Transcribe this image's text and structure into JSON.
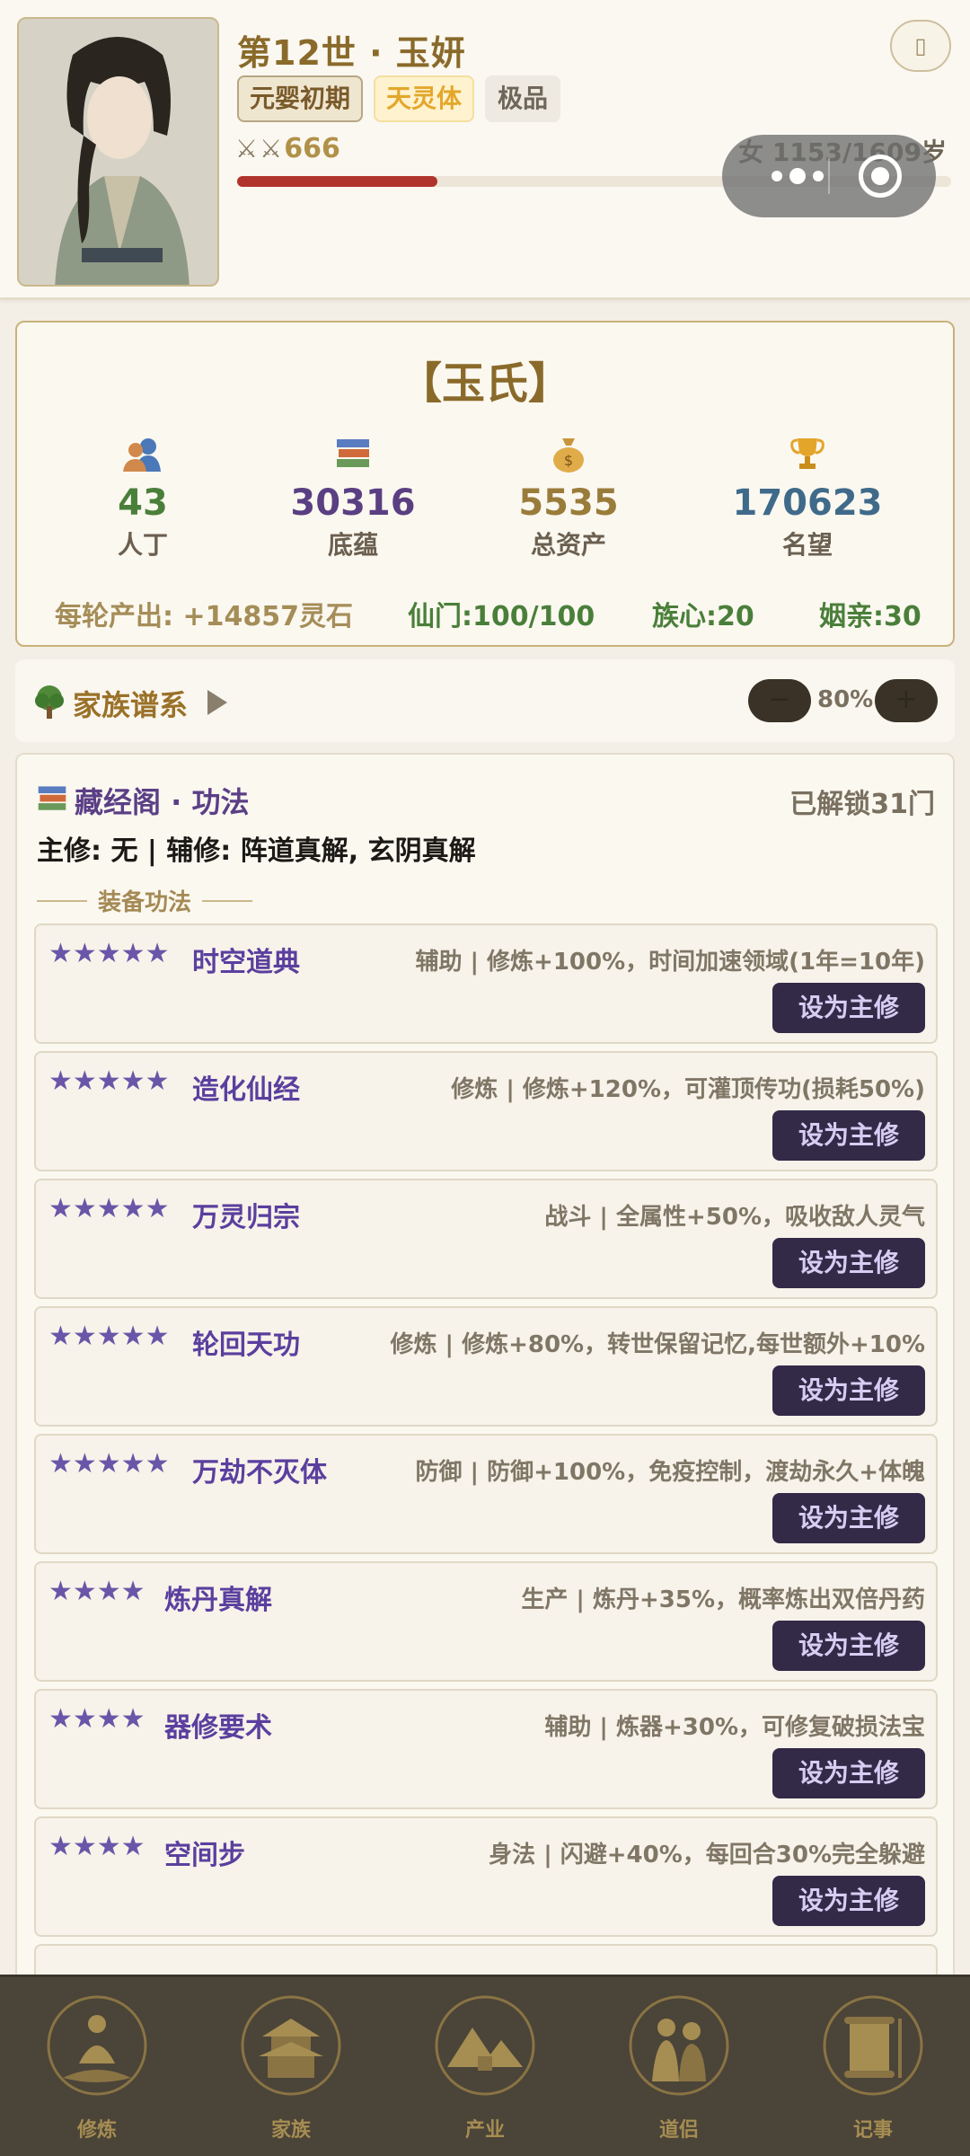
{
  "header": {
    "title": "第12世 · 玉妍",
    "badges": {
      "realm": "元婴初期",
      "body": "天灵体",
      "grade": "极品"
    },
    "power": "666",
    "age": "女 1153/1609岁",
    "hp_fraction": 0.28
  },
  "clan": {
    "name": "【玉氏】",
    "stats": [
      {
        "value": "43",
        "label": "人丁",
        "icon": "people-icon"
      },
      {
        "value": "30316",
        "label": "底蕴",
        "icon": "books-icon"
      },
      {
        "value": "5535",
        "label": "总资产",
        "icon": "money-bag-icon"
      },
      {
        "value": "170623",
        "label": "名望",
        "icon": "trophy-icon"
      }
    ],
    "footer": {
      "output": "每轮产出: +14857灵石",
      "sect": "仙门:100/100",
      "heart": "族心:20",
      "marriage": "姻亲:30"
    }
  },
  "family": {
    "label": "家族谱系",
    "zoom": "80%",
    "zoom_minus": "−",
    "zoom_plus": "+"
  },
  "library": {
    "title": "藏经阁 · 功法",
    "unlocked": "已解锁31门",
    "cultivation": "主修: 无 | 辅修: 阵道真解, 玄阴真解",
    "section_label": "装备功法",
    "button_label": "设为主修",
    "skills": [
      {
        "stars": "★★★★★",
        "name": "时空道典",
        "desc": "辅助 | 修炼+100%，时间加速领域(1年=10年)"
      },
      {
        "stars": "★★★★★",
        "name": "造化仙经",
        "desc": "修炼 | 修炼+120%，可灌顶传功(损耗50%)"
      },
      {
        "stars": "★★★★★",
        "name": "万灵归宗",
        "desc": "战斗 | 全属性+50%，吸收敌人灵气"
      },
      {
        "stars": "★★★★★",
        "name": "轮回天功",
        "desc": "修炼 | 修炼+80%，转世保留记忆,每世额外+10%"
      },
      {
        "stars": "★★★★★",
        "name": "万劫不灭体",
        "desc": "防御 | 防御+100%，免疫控制，渡劫永久+体魄"
      },
      {
        "stars": "★★★★",
        "name": "炼丹真解",
        "desc": "生产 | 炼丹+35%，概率炼出双倍丹药"
      },
      {
        "stars": "★★★★",
        "name": "器修要术",
        "desc": "辅助 | 炼器+30%，可修复破损法宝"
      },
      {
        "stars": "★★★★",
        "name": "空间步",
        "desc": "身法 | 闪避+40%，每回合30%完全躲避"
      }
    ]
  },
  "nav": [
    {
      "label": "修炼",
      "icon": "meditation-icon"
    },
    {
      "label": "家族",
      "icon": "pavilion-icon"
    },
    {
      "label": "产业",
      "icon": "mountain-icon"
    },
    {
      "label": "道侣",
      "icon": "couple-icon"
    },
    {
      "label": "记事",
      "icon": "scroll-icon"
    }
  ]
}
